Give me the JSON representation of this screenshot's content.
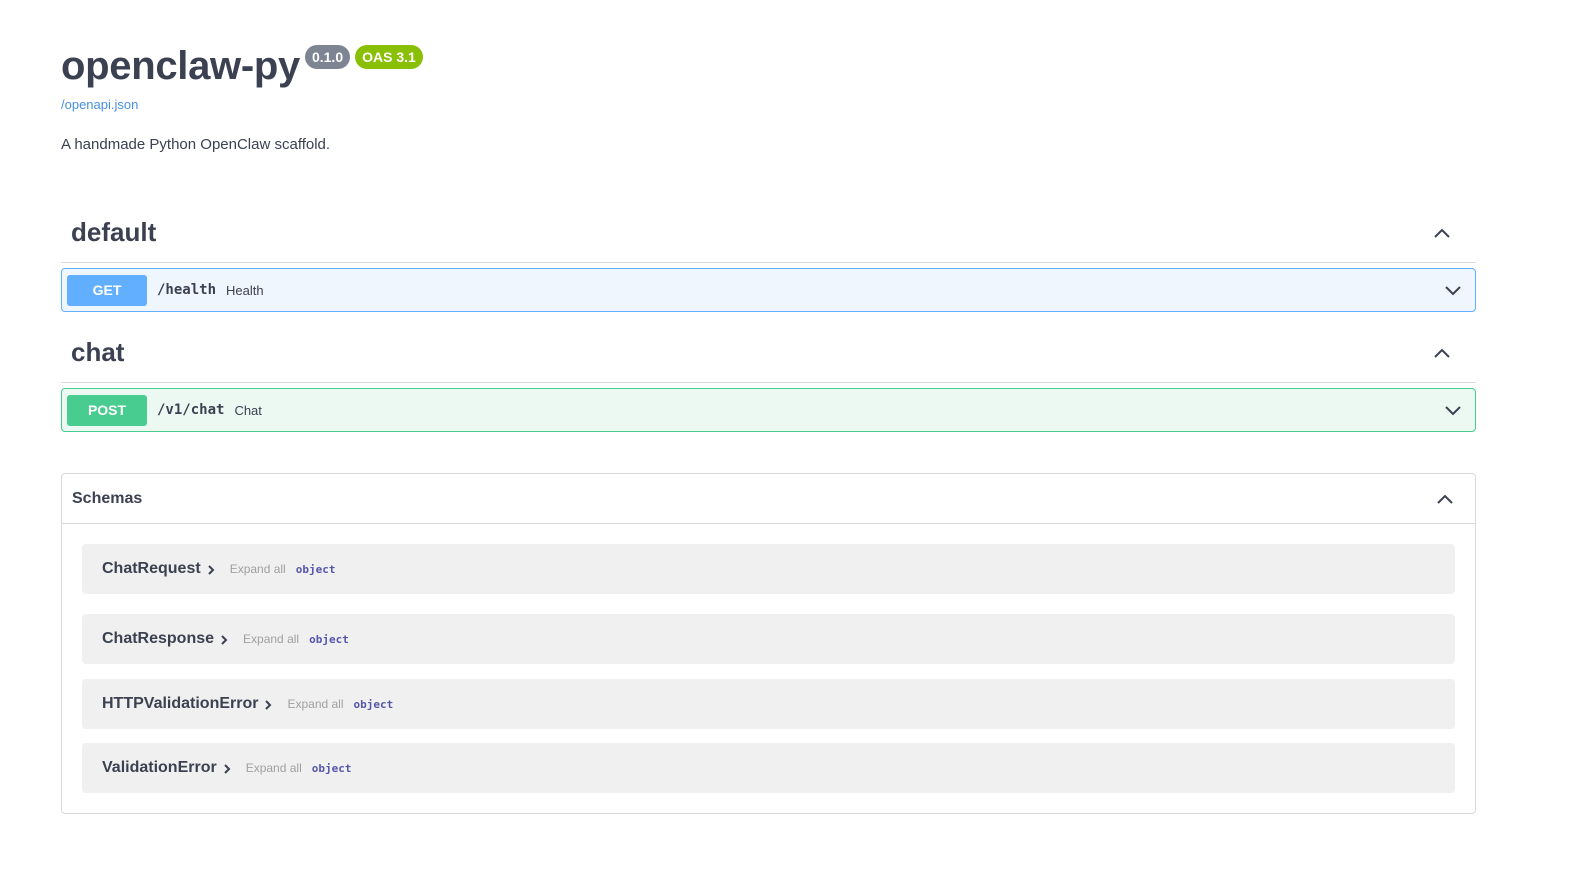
{
  "info": {
    "title": "openclaw-py",
    "version_badge": "0.1.0",
    "oas_badge": "OAS 3.1",
    "spec_link": "/openapi.json",
    "description": "A handmade Python OpenClaw scaffold."
  },
  "tags": [
    {
      "name": "default",
      "operations": [
        {
          "method": "GET",
          "path": "/health",
          "summary": "Health"
        }
      ]
    },
    {
      "name": "chat",
      "operations": [
        {
          "method": "POST",
          "path": "/v1/chat",
          "summary": "Chat"
        }
      ]
    }
  ],
  "schemas": {
    "title": "Schemas",
    "models": [
      {
        "name": "ChatRequest",
        "expand_label": "Expand all",
        "type": "object"
      },
      {
        "name": "ChatResponse",
        "expand_label": "Expand all",
        "type": "object"
      },
      {
        "name": "HTTPValidationError",
        "expand_label": "Expand all",
        "type": "object"
      },
      {
        "name": "ValidationError",
        "expand_label": "Expand all",
        "type": "object"
      }
    ]
  },
  "colors": {
    "get": "#61affe",
    "post": "#49cc90",
    "version_badge": "#7d8492",
    "oas_badge": "#89bf04",
    "link": "#4990e2"
  },
  "icons": {
    "section_toggle": "chevron-up-icon",
    "operation_toggle": "chevron-down-icon",
    "model_toggle": "chevron-right-icon"
  }
}
